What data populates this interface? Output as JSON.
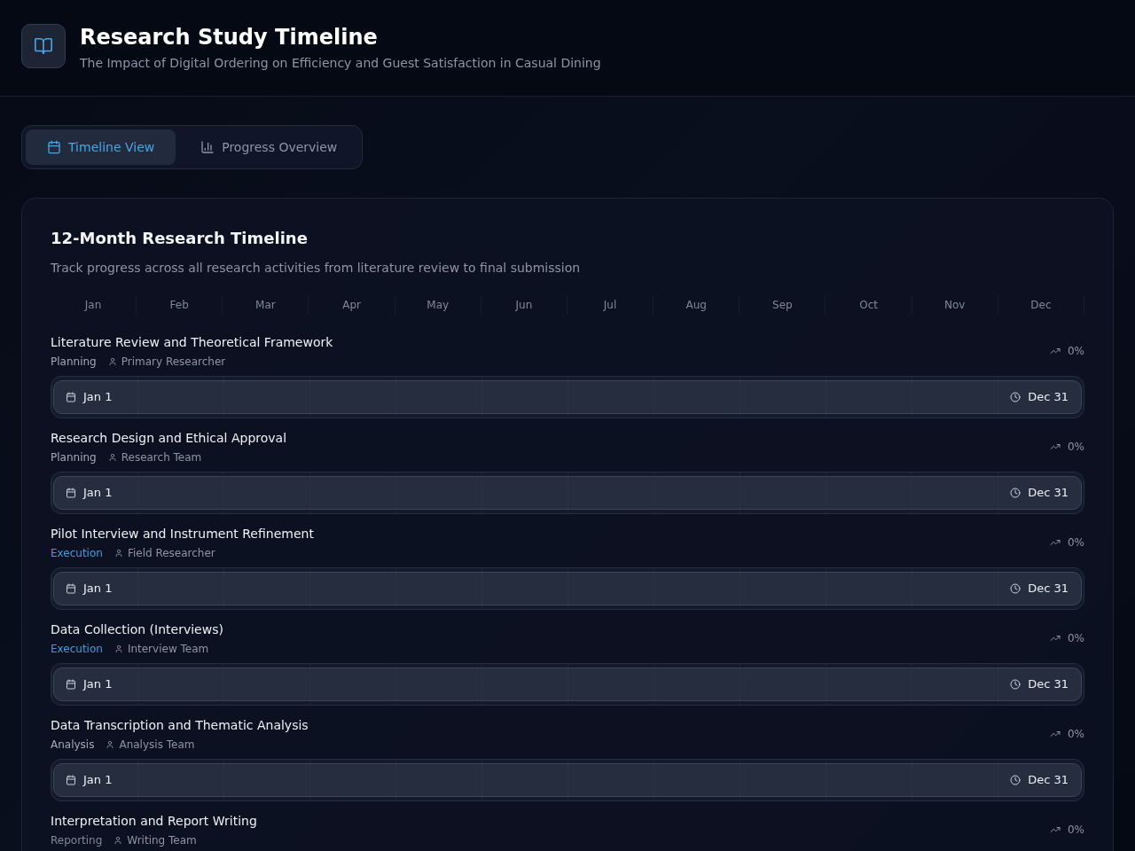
{
  "header": {
    "title": "Research Study Timeline",
    "subtitle": "The Impact of Digital Ordering on Efficiency and Guest Satisfaction in Casual Dining"
  },
  "tabs": [
    {
      "label": "Timeline View",
      "selected": true
    },
    {
      "label": "Progress Overview",
      "selected": false
    }
  ],
  "timeline": {
    "title": "12-Month Research Timeline",
    "description": "Track progress across all research activities from literature review to final submission",
    "months": [
      "Jan",
      "Feb",
      "Mar",
      "Apr",
      "May",
      "Jun",
      "Jul",
      "Aug",
      "Sep",
      "Oct",
      "Nov",
      "Dec"
    ],
    "activities": [
      {
        "title": "Literature Review and Theoretical Framework",
        "phase": "Planning",
        "color": "#a3aab7",
        "owner": "Primary Researcher",
        "progress": "0%",
        "start": "Jan 1",
        "end": "Dec 31"
      },
      {
        "title": "Research Design and Ethical Approval",
        "phase": "Planning",
        "color": "#a3aab7",
        "owner": "Research Team",
        "progress": "0%",
        "start": "Jan 1",
        "end": "Dec 31"
      },
      {
        "title": "Pilot Interview and Instrument Refinement",
        "phase": "Execution",
        "color": "#3d9fe0",
        "owner": "Field Researcher",
        "progress": "0%",
        "start": "Jan 1",
        "end": "Dec 31"
      },
      {
        "title": "Data Collection (Interviews)",
        "phase": "Execution",
        "color": "#3d9fe0",
        "owner": "Interview Team",
        "progress": "0%",
        "start": "Jan 1",
        "end": "Dec 31"
      },
      {
        "title": "Data Transcription and Thematic Analysis",
        "phase": "Analysis",
        "color": "#a3aab7",
        "owner": "Analysis Team",
        "progress": "0%",
        "start": "Jan 1",
        "end": "Dec 31"
      },
      {
        "title": "Interpretation and Report Writing",
        "phase": "Reporting",
        "color": "#7f8898",
        "owner": "Writing Team",
        "progress": "0%"
      }
    ]
  }
}
